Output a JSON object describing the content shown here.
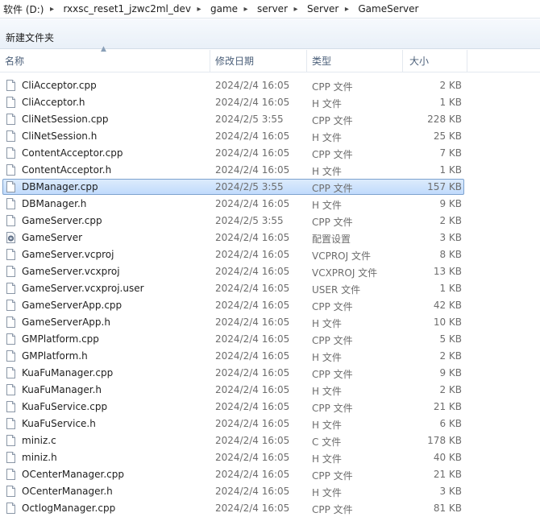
{
  "breadcrumb": [
    "软件 (D:)",
    "rxxsc_reset1_jzwc2ml_dev",
    "game",
    "server",
    "Server",
    "GameServer"
  ],
  "toolbar": {
    "new_folder_label": "新建文件夹"
  },
  "columns": {
    "name": "名称",
    "modified": "修改日期",
    "type": "类型",
    "size": "大小"
  },
  "selected_index": 6,
  "files": [
    {
      "name": "CliAcceptor.cpp",
      "modified": "2024/2/4 16:05",
      "type": "CPP 文件",
      "size": "2 KB",
      "icon": "file-icon"
    },
    {
      "name": "CliAcceptor.h",
      "modified": "2024/2/4 16:05",
      "type": "H 文件",
      "size": "1 KB",
      "icon": "file-icon"
    },
    {
      "name": "CliNetSession.cpp",
      "modified": "2024/2/5 3:55",
      "type": "CPP 文件",
      "size": "228 KB",
      "icon": "file-icon"
    },
    {
      "name": "CliNetSession.h",
      "modified": "2024/2/4 16:05",
      "type": "H 文件",
      "size": "25 KB",
      "icon": "file-icon"
    },
    {
      "name": "ContentAcceptor.cpp",
      "modified": "2024/2/4 16:05",
      "type": "CPP 文件",
      "size": "7 KB",
      "icon": "file-icon"
    },
    {
      "name": "ContentAcceptor.h",
      "modified": "2024/2/4 16:05",
      "type": "H 文件",
      "size": "1 KB",
      "icon": "file-icon"
    },
    {
      "name": "DBManager.cpp",
      "modified": "2024/2/5 3:55",
      "type": "CPP 文件",
      "size": "157 KB",
      "icon": "file-icon"
    },
    {
      "name": "DBManager.h",
      "modified": "2024/2/4 16:05",
      "type": "H 文件",
      "size": "9 KB",
      "icon": "file-icon"
    },
    {
      "name": "GameServer.cpp",
      "modified": "2024/2/5 3:55",
      "type": "CPP 文件",
      "size": "2 KB",
      "icon": "file-icon"
    },
    {
      "name": "GameServer",
      "modified": "2024/2/4 16:05",
      "type": "配置设置",
      "size": "3 KB",
      "icon": "config-file-icon"
    },
    {
      "name": "GameServer.vcproj",
      "modified": "2024/2/4 16:05",
      "type": "VCPROJ 文件",
      "size": "8 KB",
      "icon": "file-icon"
    },
    {
      "name": "GameServer.vcxproj",
      "modified": "2024/2/4 16:05",
      "type": "VCXPROJ 文件",
      "size": "13 KB",
      "icon": "file-icon"
    },
    {
      "name": "GameServer.vcxproj.user",
      "modified": "2024/2/4 16:05",
      "type": "USER 文件",
      "size": "1 KB",
      "icon": "file-icon"
    },
    {
      "name": "GameServerApp.cpp",
      "modified": "2024/2/4 16:05",
      "type": "CPP 文件",
      "size": "42 KB",
      "icon": "file-icon"
    },
    {
      "name": "GameServerApp.h",
      "modified": "2024/2/4 16:05",
      "type": "H 文件",
      "size": "10 KB",
      "icon": "file-icon"
    },
    {
      "name": "GMPlatform.cpp",
      "modified": "2024/2/4 16:05",
      "type": "CPP 文件",
      "size": "5 KB",
      "icon": "file-icon"
    },
    {
      "name": "GMPlatform.h",
      "modified": "2024/2/4 16:05",
      "type": "H 文件",
      "size": "2 KB",
      "icon": "file-icon"
    },
    {
      "name": "KuaFuManager.cpp",
      "modified": "2024/2/4 16:05",
      "type": "CPP 文件",
      "size": "9 KB",
      "icon": "file-icon"
    },
    {
      "name": "KuaFuManager.h",
      "modified": "2024/2/4 16:05",
      "type": "H 文件",
      "size": "2 KB",
      "icon": "file-icon"
    },
    {
      "name": "KuaFuService.cpp",
      "modified": "2024/2/4 16:05",
      "type": "CPP 文件",
      "size": "21 KB",
      "icon": "file-icon"
    },
    {
      "name": "KuaFuService.h",
      "modified": "2024/2/4 16:05",
      "type": "H 文件",
      "size": "6 KB",
      "icon": "file-icon"
    },
    {
      "name": "miniz.c",
      "modified": "2024/2/4 16:05",
      "type": "C 文件",
      "size": "178 KB",
      "icon": "file-icon"
    },
    {
      "name": "miniz.h",
      "modified": "2024/2/4 16:05",
      "type": "H 文件",
      "size": "40 KB",
      "icon": "file-icon"
    },
    {
      "name": "OCenterManager.cpp",
      "modified": "2024/2/4 16:05",
      "type": "CPP 文件",
      "size": "21 KB",
      "icon": "file-icon"
    },
    {
      "name": "OCenterManager.h",
      "modified": "2024/2/4 16:05",
      "type": "H 文件",
      "size": "3 KB",
      "icon": "file-icon"
    },
    {
      "name": "OctlogManager.cpp",
      "modified": "2024/2/4 16:05",
      "type": "CPP 文件",
      "size": "81 KB",
      "icon": "file-icon"
    }
  ]
}
